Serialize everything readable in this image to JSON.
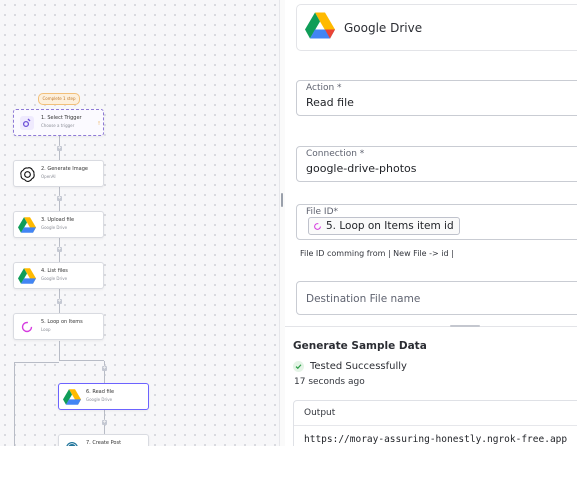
{
  "flow": {
    "badge": "Complete 1 step",
    "nodes": [
      {
        "id": "trigger",
        "title": "1. Select Trigger",
        "subtitle": "Choose a trigger",
        "icon": "trigger-icon"
      },
      {
        "id": "generate",
        "title": "2. Generate Image",
        "subtitle": "OpenAI",
        "icon": "openai-icon"
      },
      {
        "id": "upload",
        "title": "3. Upload file",
        "subtitle": "Google Drive",
        "icon": "google-drive-icon"
      },
      {
        "id": "list",
        "title": "4. List files",
        "subtitle": "Google Drive",
        "icon": "google-drive-icon"
      },
      {
        "id": "loop",
        "title": "5. Loop on Items",
        "subtitle": "Loop",
        "icon": "loop-icon"
      },
      {
        "id": "read",
        "title": "6. Read file",
        "subtitle": "Google Drive",
        "icon": "google-drive-icon"
      },
      {
        "id": "post",
        "title": "7. Create Post",
        "subtitle": "",
        "icon": "wordpress-icon"
      }
    ],
    "warning_glyph": "!"
  },
  "panel": {
    "piece_name": "Google Drive",
    "action": {
      "label": "Action *",
      "value": "Read file"
    },
    "connection": {
      "label": "Connection *",
      "value": "google-drive-photos"
    },
    "file_id": {
      "label": "File ID*",
      "chip": "5. Loop on Items item id",
      "help": "File ID comming from | New File -> id |"
    },
    "destination": {
      "placeholder": "Destination File name"
    },
    "sample": {
      "title": "Generate Sample Data",
      "status": "Tested Successfully",
      "time_ago": "17 seconds ago",
      "output_label": "Output",
      "output_value": "https://moray-assuring-honestly.ngrok-free.app"
    }
  },
  "colors": {
    "accent": "#6c63ff",
    "success": "#2e9e48",
    "canvas_bg": "#f7f7f9",
    "loop_pink": "#d63ce0"
  }
}
